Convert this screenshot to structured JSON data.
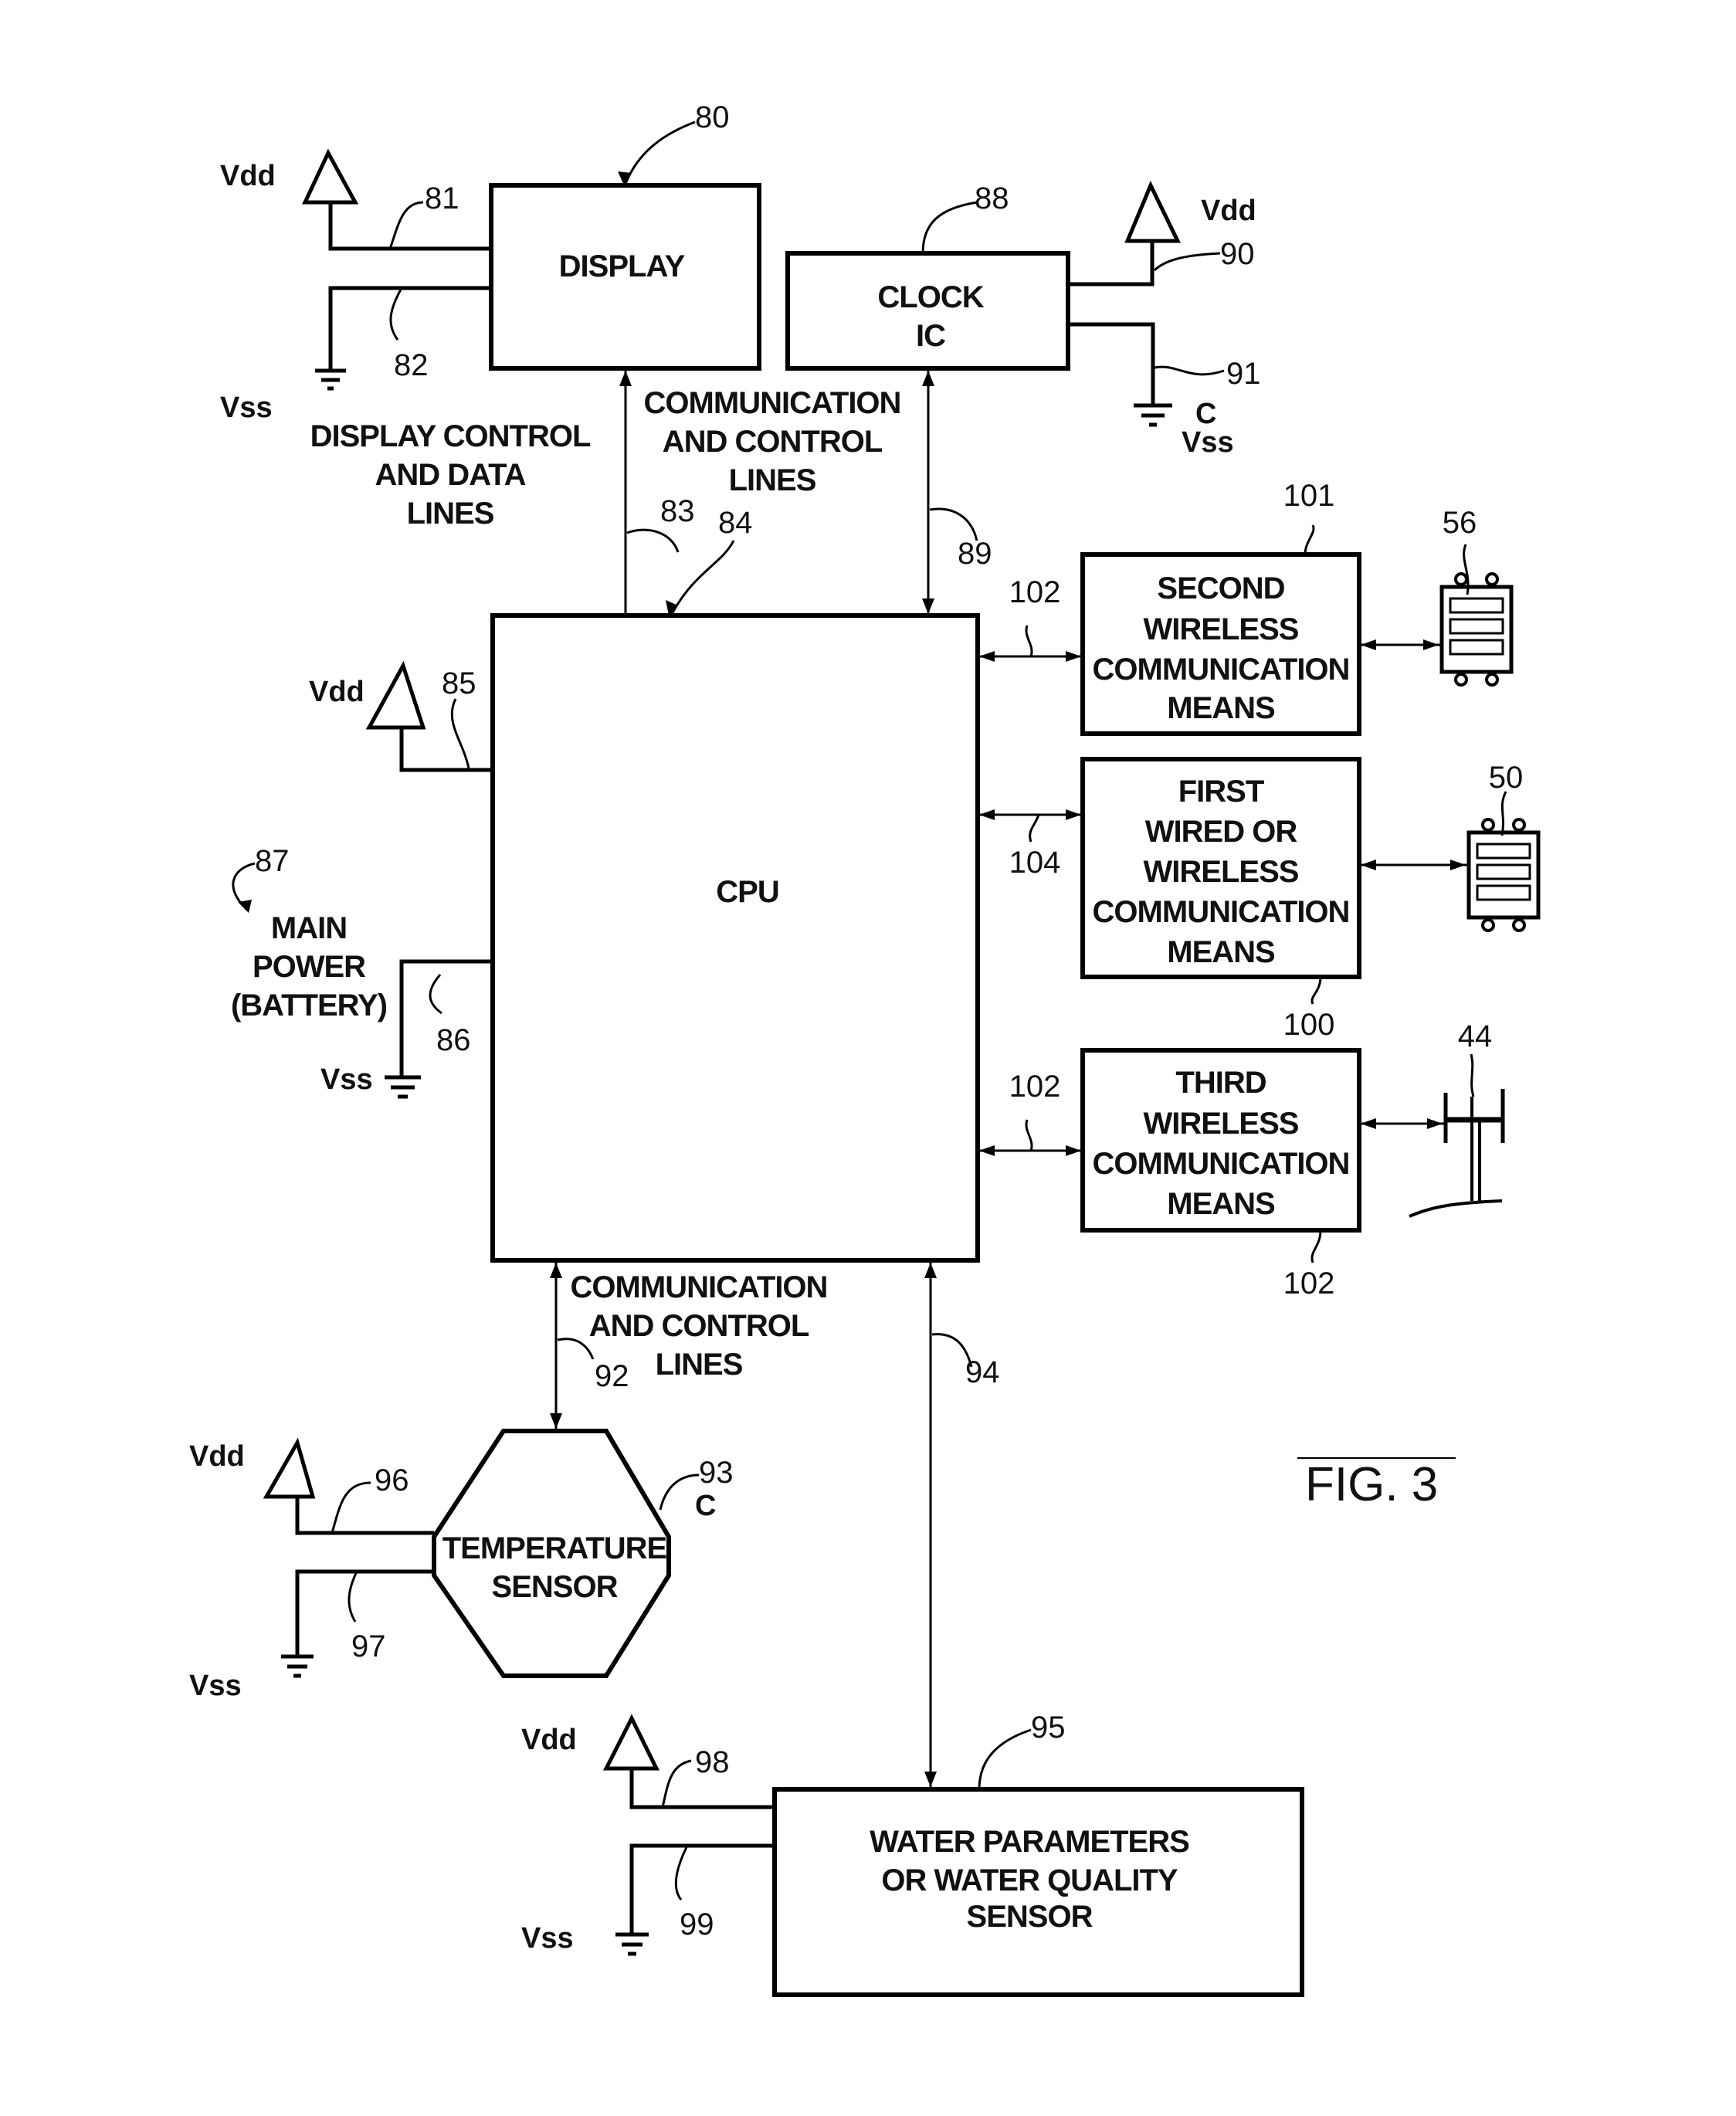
{
  "figure": {
    "title": "FIG. 3"
  },
  "blocks": {
    "display": {
      "label": [
        "DISPLAY"
      ],
      "ref": "80"
    },
    "clock": {
      "label": [
        "CLOCK",
        "IC"
      ],
      "ref": "88"
    },
    "cpu": {
      "label": [
        "CPU"
      ],
      "ref": "84"
    },
    "second_wireless": {
      "label": [
        "SECOND",
        "WIRELESS",
        "COMMUNICATION",
        "MEANS"
      ],
      "ref": "101"
    },
    "first_wired": {
      "label": [
        "FIRST",
        "WIRED OR",
        "WIRELESS",
        "COMMUNICATION",
        "MEANS"
      ],
      "ref": "100"
    },
    "third_wireless": {
      "label": [
        "THIRD",
        "WIRELESS",
        "COMMUNICATION",
        "MEANS"
      ],
      "ref": "102"
    },
    "temperature_sensor": {
      "label": [
        "TEMPERATURE",
        "SENSOR"
      ],
      "ref": "93",
      "note": "C"
    },
    "water_sensor": {
      "label": [
        "WATER PARAMETERS",
        "OR WATER QUALITY",
        "SENSOR"
      ],
      "ref": "95"
    }
  },
  "annotations": {
    "display_lines": [
      "DISPLAY CONTROL",
      "AND DATA",
      "LINES"
    ],
    "comm_lines_top": [
      "COMMUNICATION",
      "AND CONTROL",
      "LINES"
    ],
    "comm_lines_bottom": [
      "COMMUNICATION",
      "AND CONTROL",
      "LINES"
    ],
    "main_power": [
      "MAIN",
      "POWER",
      "(BATTERY)"
    ],
    "clock_note": "C"
  },
  "power": {
    "vdd": "Vdd",
    "vss": "Vss"
  },
  "refs": {
    "r81": "81",
    "r82": "82",
    "r83": "83",
    "r84": "84",
    "r85": "85",
    "r86": "86",
    "r87": "87",
    "r88": "88",
    "r89": "89",
    "r90": "90",
    "r91": "91",
    "r92": "92",
    "r93": "93",
    "r94": "94",
    "r95": "95",
    "r96": "96",
    "r97": "97",
    "r98": "98",
    "r99": "99",
    "r100": "100",
    "r101": "101",
    "r102a": "102",
    "r102b": "102",
    "r102c": "102",
    "r104": "104",
    "r56": "56",
    "r50": "50",
    "r44": "44"
  },
  "devices": {
    "remote_56": "device-56",
    "remote_50": "device-50",
    "tower_44": "antenna-tower-44"
  }
}
